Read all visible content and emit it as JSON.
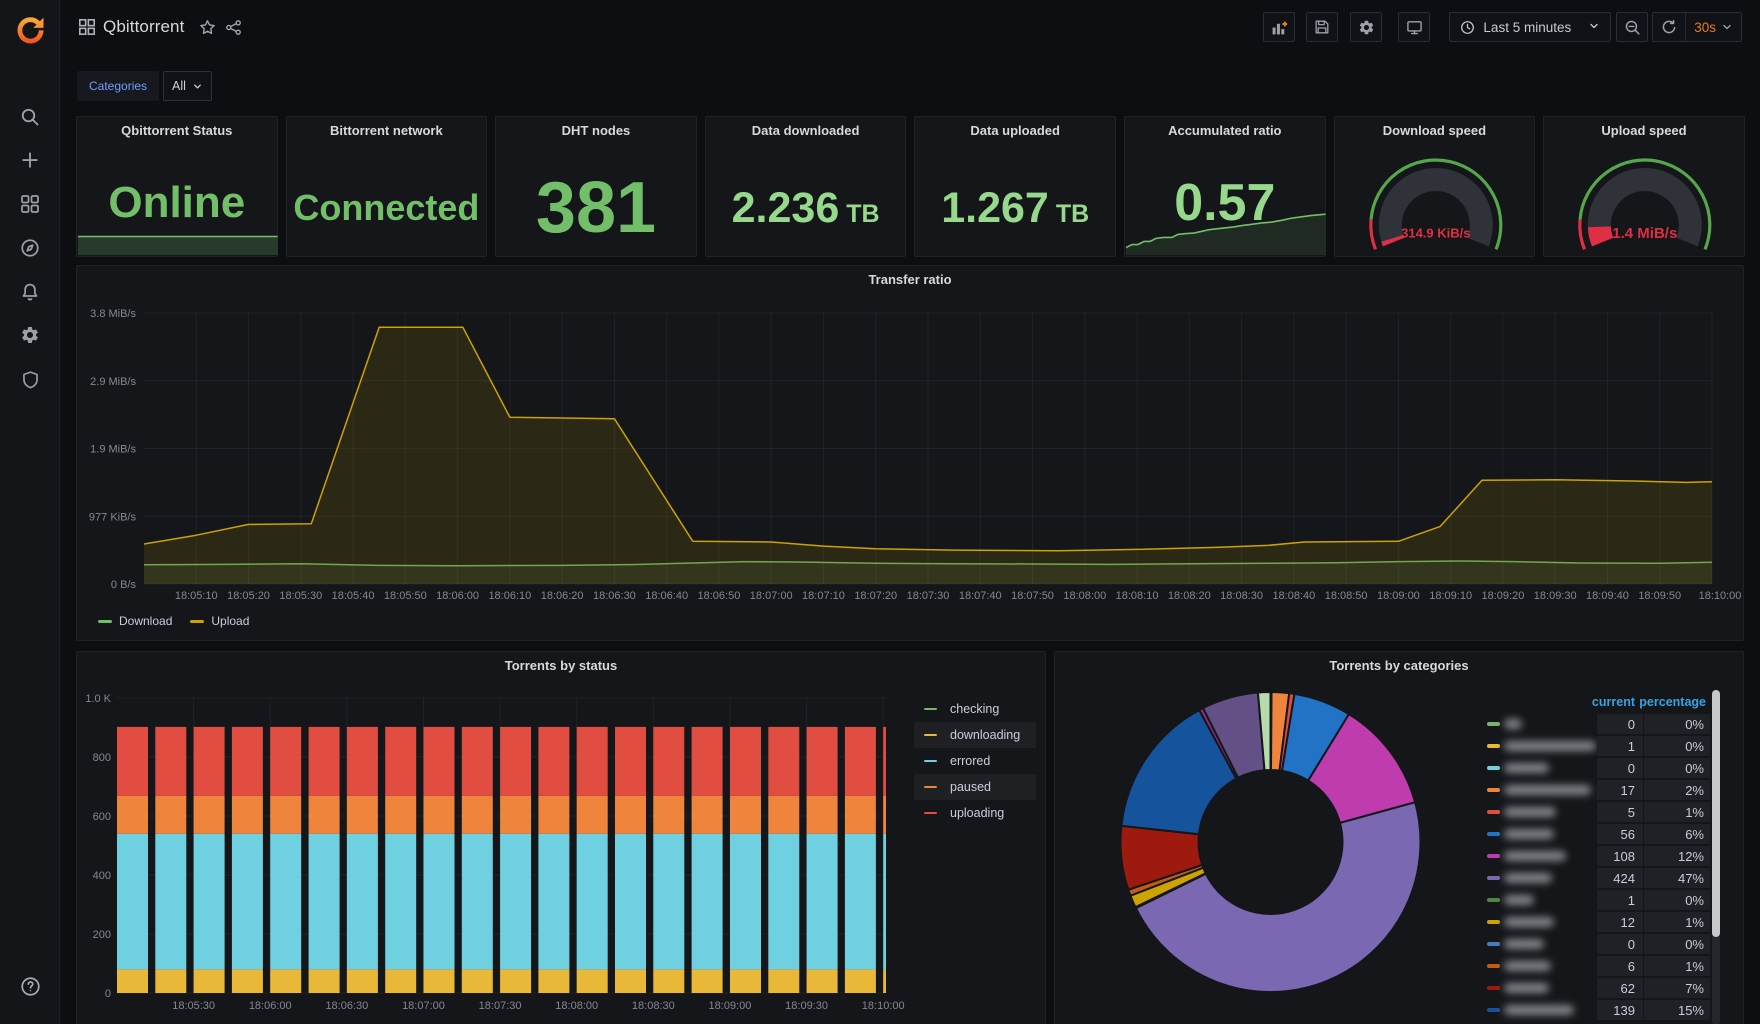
{
  "sidebar": {
    "icons": [
      "grafana-logo",
      "search",
      "create",
      "dashboards",
      "explore",
      "alerting",
      "configuration",
      "server-admin"
    ],
    "bottom_icons": [
      "help"
    ]
  },
  "header": {
    "title": "Qbittorrent",
    "title_actions": [
      "star",
      "share"
    ],
    "breadcrumb_icon": "apps-grid",
    "toolbar_icons": [
      "add-panel",
      "save-dashboard",
      "dashboard-settings",
      "kiosk-mode",
      "time-range-picker",
      "zoom-out",
      "refresh"
    ],
    "time_range_label": "Last 5 minutes",
    "refresh_interval": "30s"
  },
  "submenu": {
    "variable_label": "Categories",
    "variable_value": "All"
  },
  "stats": [
    {
      "id": "qbittorrent-status",
      "title": "Qbittorrent Status",
      "type": "stat",
      "value": "Online",
      "unit": "",
      "color": "#73bf69",
      "font": 44,
      "sparkline": {
        "kind": "flat",
        "points": [
          [
            0,
            1
          ],
          [
            1,
            1
          ]
        ]
      }
    },
    {
      "id": "bittorrent-network",
      "title": "Bittorrent network",
      "type": "stat",
      "value": "Connected",
      "unit": "",
      "color": "#73bf69",
      "font": 36
    },
    {
      "id": "dht-nodes",
      "title": "DHT nodes",
      "type": "stat",
      "value": "381",
      "unit": "",
      "color": "#73bf69",
      "font": 72
    },
    {
      "id": "data-downloaded",
      "title": "Data downloaded",
      "type": "stat",
      "value": "2.236",
      "unit": "TB",
      "color": "#96d98d",
      "font": 43
    },
    {
      "id": "data-uploaded",
      "title": "Data uploaded",
      "type": "stat",
      "value": "1.267",
      "unit": "TB",
      "color": "#96d98d",
      "font": 43
    },
    {
      "id": "accumulated-ratio",
      "title": "Accumulated ratio",
      "type": "stat",
      "value": "0.57",
      "unit": "",
      "color": "#96d98d",
      "font": 52,
      "sparkline": {
        "kind": "rising",
        "points": [
          [
            0,
            0.1
          ],
          [
            0.03,
            0.17
          ],
          [
            0.06,
            0.17
          ],
          [
            0.09,
            0.24
          ],
          [
            0.12,
            0.24
          ],
          [
            0.15,
            0.31
          ],
          [
            0.19,
            0.33
          ],
          [
            0.23,
            0.33
          ],
          [
            0.26,
            0.4
          ],
          [
            0.3,
            0.42
          ],
          [
            0.34,
            0.43
          ],
          [
            0.38,
            0.47
          ],
          [
            0.42,
            0.51
          ],
          [
            0.46,
            0.53
          ],
          [
            0.5,
            0.55
          ],
          [
            0.54,
            0.57
          ],
          [
            0.58,
            0.6
          ],
          [
            0.63,
            0.63
          ],
          [
            0.68,
            0.66
          ],
          [
            0.73,
            0.68
          ],
          [
            0.78,
            0.72
          ],
          [
            0.83,
            0.77
          ],
          [
            0.88,
            0.8
          ],
          [
            0.93,
            0.83
          ],
          [
            1,
            0.86
          ]
        ]
      }
    },
    {
      "id": "download-speed",
      "title": "Download speed",
      "type": "gauge",
      "value": "314.9 KiB/s",
      "fraction": 0.022,
      "threshold_fraction": 0.12,
      "value_font": 13,
      "value_color": "#e02f44"
    },
    {
      "id": "upload-speed",
      "title": "Upload speed",
      "type": "gauge",
      "value": "1.4 MiB/s",
      "fraction": 0.088,
      "threshold_fraction": 0.12,
      "value_font": 15,
      "value_color": "#e02f44"
    }
  ],
  "chart_data": [
    {
      "id": "transfer",
      "type": "area",
      "title": "Transfer ratio",
      "x_axis": "time, seconds after 18:05:00",
      "x_range": [
        0,
        300
      ],
      "y_unit": "MB/s",
      "y_max": 4,
      "y_ticks": [
        {
          "v": 0,
          "label": "0 B/s"
        },
        {
          "v": 1,
          "label": "977 KiB/s"
        },
        {
          "v": 2,
          "label": "1.9 MiB/s"
        },
        {
          "v": 3,
          "label": "2.9 MiB/s"
        },
        {
          "v": 4,
          "label": "3.8 MiB/s"
        }
      ],
      "x_ticks": [
        {
          "t": 10,
          "label": "18:05:10"
        },
        {
          "t": 20,
          "label": "18:05:20"
        },
        {
          "t": 30,
          "label": "18:05:30"
        },
        {
          "t": 40,
          "label": "18:05:40"
        },
        {
          "t": 50,
          "label": "18:05:50"
        },
        {
          "t": 60,
          "label": "18:06:00"
        },
        {
          "t": 70,
          "label": "18:06:10"
        },
        {
          "t": 80,
          "label": "18:06:20"
        },
        {
          "t": 90,
          "label": "18:06:30"
        },
        {
          "t": 100,
          "label": "18:06:40"
        },
        {
          "t": 110,
          "label": "18:06:50"
        },
        {
          "t": 120,
          "label": "18:07:00"
        },
        {
          "t": 130,
          "label": "18:07:10"
        },
        {
          "t": 140,
          "label": "18:07:20"
        },
        {
          "t": 150,
          "label": "18:07:30"
        },
        {
          "t": 160,
          "label": "18:07:40"
        },
        {
          "t": 170,
          "label": "18:07:50"
        },
        {
          "t": 180,
          "label": "18:08:00"
        },
        {
          "t": 190,
          "label": "18:08:10"
        },
        {
          "t": 200,
          "label": "18:08:20"
        },
        {
          "t": 210,
          "label": "18:08:30"
        },
        {
          "t": 220,
          "label": "18:08:40"
        },
        {
          "t": 230,
          "label": "18:08:50"
        },
        {
          "t": 240,
          "label": "18:09:00"
        },
        {
          "t": 250,
          "label": "18:09:10"
        },
        {
          "t": 260,
          "label": "18:09:20"
        },
        {
          "t": 270,
          "label": "18:09:30"
        },
        {
          "t": 280,
          "label": "18:09:40"
        },
        {
          "t": 290,
          "label": "18:09:50"
        },
        {
          "t": 300,
          "label": "18:10:00"
        }
      ],
      "series": [
        {
          "name": "Download",
          "color": "#73bf69",
          "fill": "rgba(115,191,105,0.10)",
          "points": [
            [
              0,
              0.285
            ],
            [
              15,
              0.29
            ],
            [
              30,
              0.3
            ],
            [
              45,
              0.275
            ],
            [
              60,
              0.27
            ],
            [
              80,
              0.275
            ],
            [
              95,
              0.29
            ],
            [
              105,
              0.31
            ],
            [
              115,
              0.33
            ],
            [
              125,
              0.325
            ],
            [
              140,
              0.305
            ],
            [
              155,
              0.3
            ],
            [
              170,
              0.295
            ],
            [
              185,
              0.29
            ],
            [
              200,
              0.3
            ],
            [
              215,
              0.305
            ],
            [
              228,
              0.315
            ],
            [
              240,
              0.33
            ],
            [
              252,
              0.34
            ],
            [
              262,
              0.33
            ],
            [
              275,
              0.31
            ],
            [
              290,
              0.305
            ],
            [
              300,
              0.32
            ]
          ]
        },
        {
          "name": "Upload",
          "color": "#cca300",
          "fill": "rgba(204,163,0,0.13)",
          "points": [
            [
              0,
              0.59
            ],
            [
              10,
              0.72
            ],
            [
              20,
              0.88
            ],
            [
              32,
              0.89
            ],
            [
              45,
              3.79
            ],
            [
              61,
              3.79
            ],
            [
              70,
              2.46
            ],
            [
              90,
              2.44
            ],
            [
              105,
              0.63
            ],
            [
              120,
              0.62
            ],
            [
              130,
              0.56
            ],
            [
              140,
              0.52
            ],
            [
              155,
              0.5
            ],
            [
              175,
              0.49
            ],
            [
              190,
              0.51
            ],
            [
              205,
              0.54
            ],
            [
              215,
              0.57
            ],
            [
              222,
              0.62
            ],
            [
              240,
              0.63
            ],
            [
              248,
              0.85
            ],
            [
              256,
              1.53
            ],
            [
              270,
              1.54
            ],
            [
              285,
              1.52
            ],
            [
              295,
              1.5
            ],
            [
              300,
              1.51
            ]
          ]
        }
      ]
    },
    {
      "id": "status",
      "type": "bar",
      "title": "Torrents by status",
      "x_axis": "time, seconds after 18:05:00",
      "bar_interval_sec": 15,
      "bar_times": [
        0,
        15,
        30,
        45,
        60,
        75,
        90,
        105,
        120,
        135,
        150,
        165,
        180,
        195,
        210,
        225,
        240,
        255,
        270,
        285,
        300
      ],
      "y_max": 1000,
      "y_ticks": [
        {
          "v": 0,
          "label": "0"
        },
        {
          "v": 200,
          "label": "200"
        },
        {
          "v": 400,
          "label": "400"
        },
        {
          "v": 600,
          "label": "600"
        },
        {
          "v": 800,
          "label": "800"
        },
        {
          "v": 1000,
          "label": "1.0 K"
        }
      ],
      "x_ticks": [
        {
          "t": 30,
          "label": "18:05:30"
        },
        {
          "t": 60,
          "label": "18:06:00"
        },
        {
          "t": 90,
          "label": "18:06:30"
        },
        {
          "t": 120,
          "label": "18:07:00"
        },
        {
          "t": 150,
          "label": "18:07:30"
        },
        {
          "t": 180,
          "label": "18:08:00"
        },
        {
          "t": 210,
          "label": "18:08:30"
        },
        {
          "t": 240,
          "label": "18:09:00"
        },
        {
          "t": 270,
          "label": "18:09:30"
        },
        {
          "t": 300,
          "label": "18:10:00"
        }
      ],
      "values_constant_per_bar": true,
      "series": [
        {
          "name": "checking",
          "color": "#7EB26D",
          "value": 0,
          "legend_highlight": false
        },
        {
          "name": "downloading",
          "color": "#EAB839",
          "value": 80,
          "legend_highlight": true
        },
        {
          "name": "errored",
          "color": "#6ED0E0",
          "value": 460,
          "legend_highlight": false
        },
        {
          "name": "paused",
          "color": "#EF843C",
          "value": 128,
          "legend_highlight": true
        },
        {
          "name": "uploading",
          "color": "#E24D42",
          "value": 234,
          "legend_highlight": false
        }
      ]
    },
    {
      "id": "categories",
      "type": "pie",
      "title": "Torrents by categories",
      "total": 902,
      "slices": [
        {
          "color": "#EAB839",
          "value": 1
        },
        {
          "color": "#EF843C",
          "value": 17
        },
        {
          "color": "#E24D42",
          "value": 5
        },
        {
          "color": "#2272c6",
          "value": 56
        },
        {
          "color": "#bf3cae",
          "value": 108
        },
        {
          "color": "#7a68b3",
          "value": 424
        },
        {
          "color": "#508642",
          "value": 1
        },
        {
          "color": "#CCA300",
          "value": 12
        },
        {
          "color": "#C15C17",
          "value": 6
        },
        {
          "color": "#9e1a0e",
          "value": 62
        },
        {
          "color": "#15549c",
          "value": 139
        },
        {
          "color": "#962D82",
          "value": 4
        },
        {
          "color": "#635087",
          "value": 55
        },
        {
          "color": "#B7DBAB",
          "value": 12
        }
      ],
      "table": {
        "columns": [
          "current",
          "percentage"
        ],
        "rows": [
          {
            "color": "#7EB26D",
            "current": "0",
            "percentage": "0%",
            "label_blur_width": 18
          },
          {
            "color": "#EAB839",
            "current": "1",
            "percentage": "0%",
            "label_blur_width": 92
          },
          {
            "color": "#6ED0E0",
            "current": "0",
            "percentage": "0%",
            "label_blur_width": 45
          },
          {
            "color": "#EF843C",
            "current": "17",
            "percentage": "2%",
            "label_blur_width": 87
          },
          {
            "color": "#E24D42",
            "current": "5",
            "percentage": "1%",
            "label_blur_width": 52
          },
          {
            "color": "#2272c6",
            "current": "56",
            "percentage": "6%",
            "label_blur_width": 50
          },
          {
            "color": "#bf3cae",
            "current": "108",
            "percentage": "12%",
            "label_blur_width": 62
          },
          {
            "color": "#7a68b3",
            "current": "424",
            "percentage": "47%",
            "label_blur_width": 48
          },
          {
            "color": "#508642",
            "current": "1",
            "percentage": "0%",
            "label_blur_width": 30
          },
          {
            "color": "#CCA300",
            "current": "12",
            "percentage": "1%",
            "label_blur_width": 50
          },
          {
            "color": "#447EBC",
            "current": "0",
            "percentage": "0%",
            "label_blur_width": 40
          },
          {
            "color": "#C15C17",
            "current": "6",
            "percentage": "1%",
            "label_blur_width": 47
          },
          {
            "color": "#9e1a0e",
            "current": "62",
            "percentage": "7%",
            "label_blur_width": 45
          },
          {
            "color": "#15549c",
            "current": "139",
            "percentage": "15%",
            "label_blur_width": 70
          }
        ]
      }
    }
  ]
}
